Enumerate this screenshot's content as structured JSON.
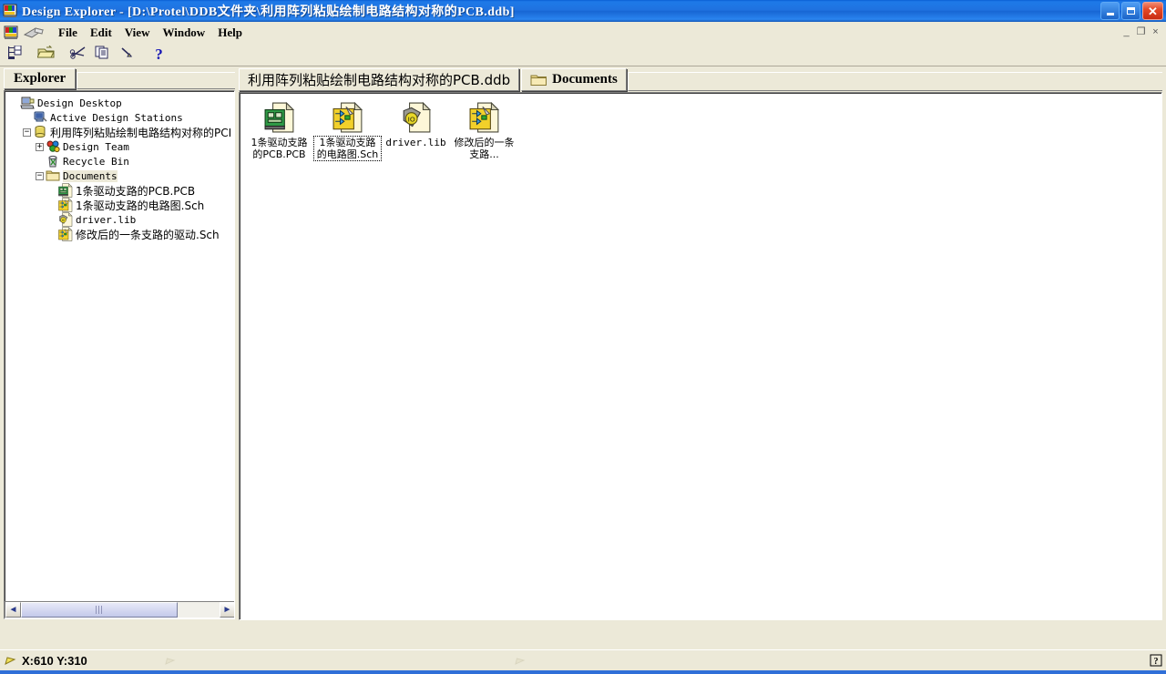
{
  "window": {
    "app_name": "Design Explorer",
    "title": "Design Explorer - [D:\\Protel\\DDB文件夹\\利用阵列粘贴绘制电路结构对称的PCB.ddb]",
    "titlebar_color": "#1f72e0",
    "face_color": "#ece9d8",
    "buttons": {
      "minimize": "minimize-button",
      "maximize": "restore-button",
      "close": "close-button"
    },
    "mdi_buttons": {
      "minimize": "_",
      "restore": "❐",
      "close": "×"
    }
  },
  "menubar": {
    "items": [
      {
        "label": "File",
        "accel": "F"
      },
      {
        "label": "Edit",
        "accel": "E"
      },
      {
        "label": "View",
        "accel": "V"
      },
      {
        "label": "Window",
        "accel": "W"
      },
      {
        "label": "Help",
        "accel": "H"
      }
    ]
  },
  "toolbar": {
    "buttons": [
      {
        "name": "toggle-explorer-panel-button",
        "icon": "tree-panel-icon"
      },
      {
        "name": "open-document-button",
        "icon": "open-folder-icon"
      },
      {
        "name": "cut-button",
        "icon": "scissors-icon"
      },
      {
        "name": "copy-button",
        "icon": "copy-pages-icon"
      },
      {
        "name": "paste-button",
        "icon": "paste-arrow-icon"
      },
      {
        "name": "help-button",
        "icon": "question-mark-icon",
        "label": "?"
      }
    ]
  },
  "explorer_panel": {
    "tab_label": "Explorer",
    "tree": [
      {
        "label": "Design Desktop",
        "icon": "desktop-icon",
        "indent": 0,
        "expander": "none",
        "script": "latin",
        "selected": false
      },
      {
        "label": "Active Design Stations",
        "icon": "computer-icon",
        "indent": 1,
        "expander": "none",
        "script": "latin",
        "selected": false
      },
      {
        "label": "利用阵列粘贴绘制电路结构对称的PCI",
        "icon": "database-icon",
        "indent": 1,
        "expander": "minus",
        "script": "cjk",
        "selected": false
      },
      {
        "label": "Design Team",
        "icon": "design-team-icon",
        "indent": 2,
        "expander": "plus",
        "script": "latin",
        "selected": false
      },
      {
        "label": "Recycle Bin",
        "icon": "recycle-bin-icon",
        "indent": 2,
        "expander": "none",
        "script": "latin",
        "selected": false
      },
      {
        "label": "Documents",
        "icon": "folder-icon",
        "indent": 2,
        "expander": "minus",
        "script": "latin",
        "selected": true
      },
      {
        "label": "1条驱动支路的PCB.PCB",
        "icon": "pcb-document-icon",
        "indent": 3,
        "expander": "none",
        "script": "cjk",
        "selected": false
      },
      {
        "label": "1条驱动支路的电路图.Sch",
        "icon": "sch-document-icon",
        "indent": 3,
        "expander": "none",
        "script": "cjk",
        "selected": false
      },
      {
        "label": "driver.lib",
        "icon": "lib-document-icon",
        "indent": 3,
        "expander": "none",
        "script": "latin",
        "selected": false
      },
      {
        "label": "修改后的一条支路的驱动.Sch",
        "icon": "sch-document-icon",
        "indent": 3,
        "expander": "none",
        "script": "cjk",
        "selected": false
      }
    ],
    "scrollbar": {
      "left_arrow": "◄",
      "right_arrow": "►"
    }
  },
  "document_panel": {
    "tabs": [
      {
        "label": "利用阵列粘贴绘制电路结构对称的PCB.ddb",
        "icon": null,
        "active": true,
        "script": "cjk"
      },
      {
        "label": "Documents",
        "icon": "folder-icon",
        "active": false,
        "script": "latin"
      }
    ],
    "items": [
      {
        "label": "1条驱动支路的PCB.PCB",
        "icon": "pcb-document-icon",
        "selected": false,
        "script": "cjk"
      },
      {
        "label": "1条驱动支路的电路图.Sch",
        "icon": "sch-document-icon",
        "selected": true,
        "script": "cjk"
      },
      {
        "label": "driver.lib",
        "icon": "lib-document-icon",
        "selected": false,
        "script": "mono"
      },
      {
        "label": "修改后的一条支路...",
        "icon": "sch-document-icon",
        "selected": false,
        "script": "cjk"
      }
    ]
  },
  "statusbar": {
    "coordinates": "X:610 Y:310",
    "pane_middle_1": "",
    "pane_middle_2": "",
    "help_icon": "?"
  }
}
